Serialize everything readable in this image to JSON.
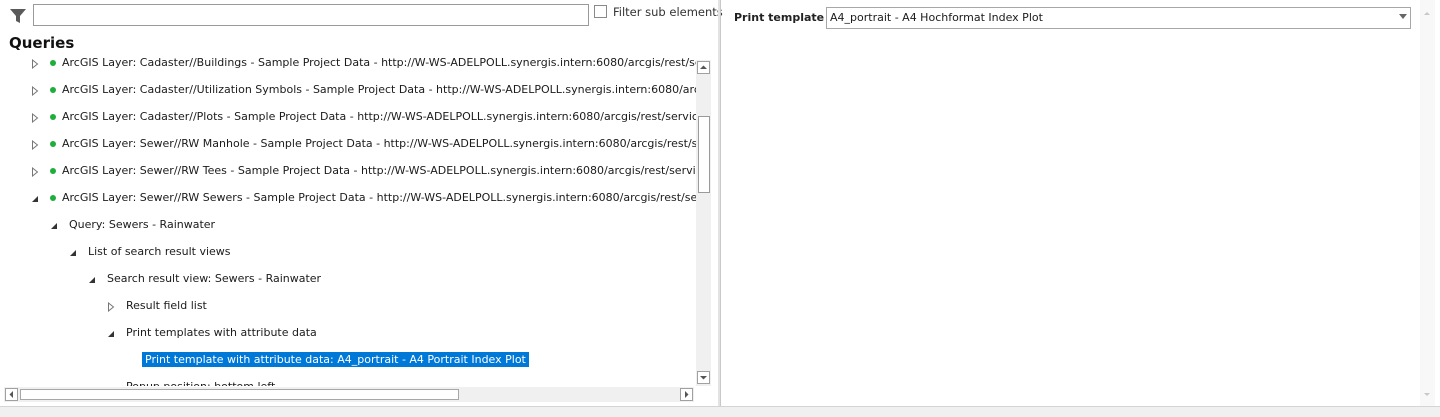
{
  "filter": {
    "search_value": "",
    "filter_sub_label": "Filter sub elements"
  },
  "tree": {
    "heading": "Queries",
    "nodes": [
      {
        "label": "ArcGIS Layer: Cadaster//Buildings - Sample Project Data - http://W-WS-ADELPOLL.synergis.intern:6080/arcgis/rest/services/Sa",
        "expanded": false,
        "status": "green"
      },
      {
        "label": "ArcGIS Layer: Cadaster//Utilization Symbols - Sample Project Data - http://W-WS-ADELPOLL.synergis.intern:6080/arcgis/rest/s",
        "expanded": false,
        "status": "green"
      },
      {
        "label": "ArcGIS Layer: Cadaster//Plots - Sample Project Data - http://W-WS-ADELPOLL.synergis.intern:6080/arcgis/rest/services/Sample",
        "expanded": false,
        "status": "green"
      },
      {
        "label": "ArcGIS Layer: Sewer//RW Manhole - Sample Project Data - http://W-WS-ADELPOLL.synergis.intern:6080/arcgis/rest/services/S",
        "expanded": false,
        "status": "green"
      },
      {
        "label": "ArcGIS Layer: Sewer//RW Tees - Sample Project Data - http://W-WS-ADELPOLL.synergis.intern:6080/arcgis/rest/services/Sampl",
        "expanded": false,
        "status": "green"
      },
      {
        "label": "ArcGIS Layer: Sewer//RW Sewers - Sample Project Data - http://W-WS-ADELPOLL.synergis.intern:6080/arcgis/rest/services/Sam",
        "expanded": true,
        "status": "green"
      },
      {
        "label": "Query: Sewers - Rainwater",
        "expanded": true
      },
      {
        "label": "List of search result views",
        "expanded": true
      },
      {
        "label": "Search result view: Sewers - Rainwater",
        "expanded": true
      },
      {
        "label": "Result field list",
        "expanded": false
      },
      {
        "label": "Print templates with attribute data",
        "expanded": true
      },
      {
        "label": "Print template with attribute data: A4_portrait - A4 Portrait Index Plot",
        "selected": true
      },
      {
        "label": "Popup position: bottom left"
      }
    ]
  },
  "properties": {
    "print_template_label": "Print template",
    "print_template_value": "A4_portrait - A4 Hochformat Index Plot"
  },
  "colors": {
    "status_green": "#1fae3c",
    "selection": "#0078d7"
  },
  "icons": {
    "filter": "funnel-icon",
    "expanded": "triangle-expanded-icon",
    "collapsed": "triangle-collapsed-icon",
    "dropdown": "chevron-down-icon"
  }
}
